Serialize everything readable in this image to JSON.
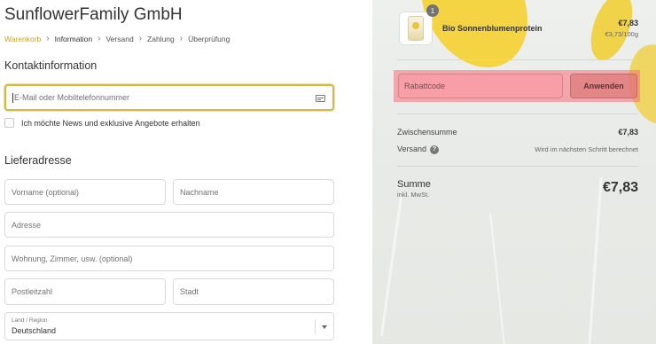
{
  "shop": {
    "name": "SunflowerFamily GmbH"
  },
  "breadcrumb": [
    {
      "label": "Warenkorb"
    },
    {
      "label": "Information"
    },
    {
      "label": "Versand"
    },
    {
      "label": "Zahlung"
    },
    {
      "label": "Überprüfung"
    }
  ],
  "contact": {
    "title": "Kontaktinformation",
    "email_placeholder": "E-Mail oder Mobiltelefonnummer",
    "newsletter_label": "Ich möchte News und exklusive Angebote erhalten"
  },
  "shipping": {
    "title": "Lieferadresse",
    "first_name_placeholder": "Vorname (optional)",
    "last_name_placeholder": "Nachname",
    "address_placeholder": "Adresse",
    "apartment_placeholder": "Wohnung, Zimmer, usw. (optional)",
    "postal_placeholder": "Postleitzahl",
    "city_placeholder": "Stadt",
    "country_label": "Land / Region",
    "country_value": "Deutschland"
  },
  "summary": {
    "product": {
      "quantity": "1",
      "name": "Bio Sonnenblumenprotein",
      "price": "€7,83",
      "unit_price": "€3,73/100g"
    },
    "discount": {
      "placeholder": "Rabattcode",
      "apply_label": "Anwenden"
    },
    "subtotal_label": "Zwischensumme",
    "subtotal_value": "€7,83",
    "shipping_label": "Versand",
    "shipping_value": "Wird im nächsten Schritt berechnet",
    "total_label": "Summe",
    "total_sub": "inkl. MwSt.",
    "total_value": "€7,83"
  },
  "colors": {
    "accent": "#d4b84a",
    "link": "#c9a227",
    "highlight": "#f56e78"
  }
}
